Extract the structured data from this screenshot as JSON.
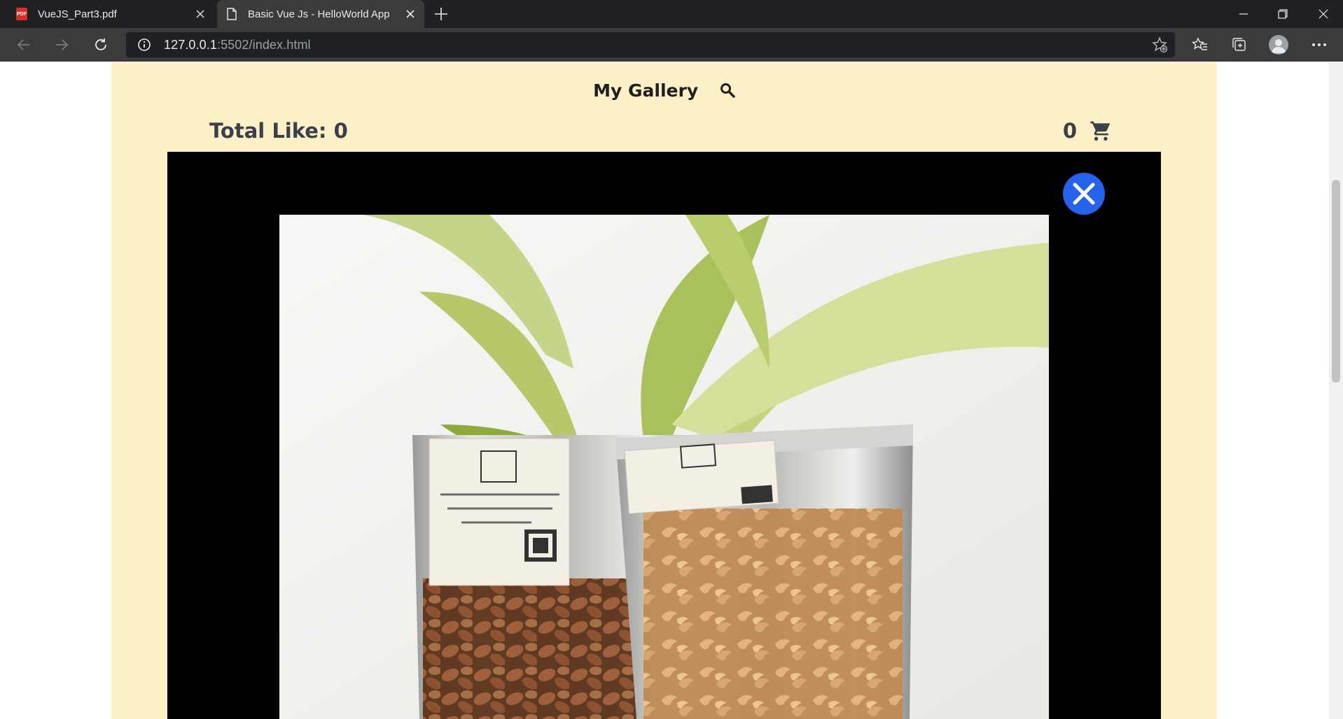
{
  "browser": {
    "tabs": [
      {
        "title": "VueJS_Part3.pdf",
        "icon": "pdf-icon",
        "active": false
      },
      {
        "title": "Basic Vue Js - HelloWorld App",
        "icon": "document-icon",
        "active": true
      }
    ],
    "url_host": "127.0.0.1",
    "url_rest": ":5502/index.html",
    "theme": {
      "tabbar": "#202124",
      "toolbar": "#3b3b3b"
    }
  },
  "page": {
    "title": "My Gallery",
    "total_like": "Total Like: 0",
    "cart_count": "0",
    "colors": {
      "background": "#fdf0c6",
      "modal": "#000000",
      "close_button": "#2563eb"
    }
  },
  "modal": {
    "close_icon": "close-icon",
    "image_subject": "nut snack bags with plant"
  }
}
